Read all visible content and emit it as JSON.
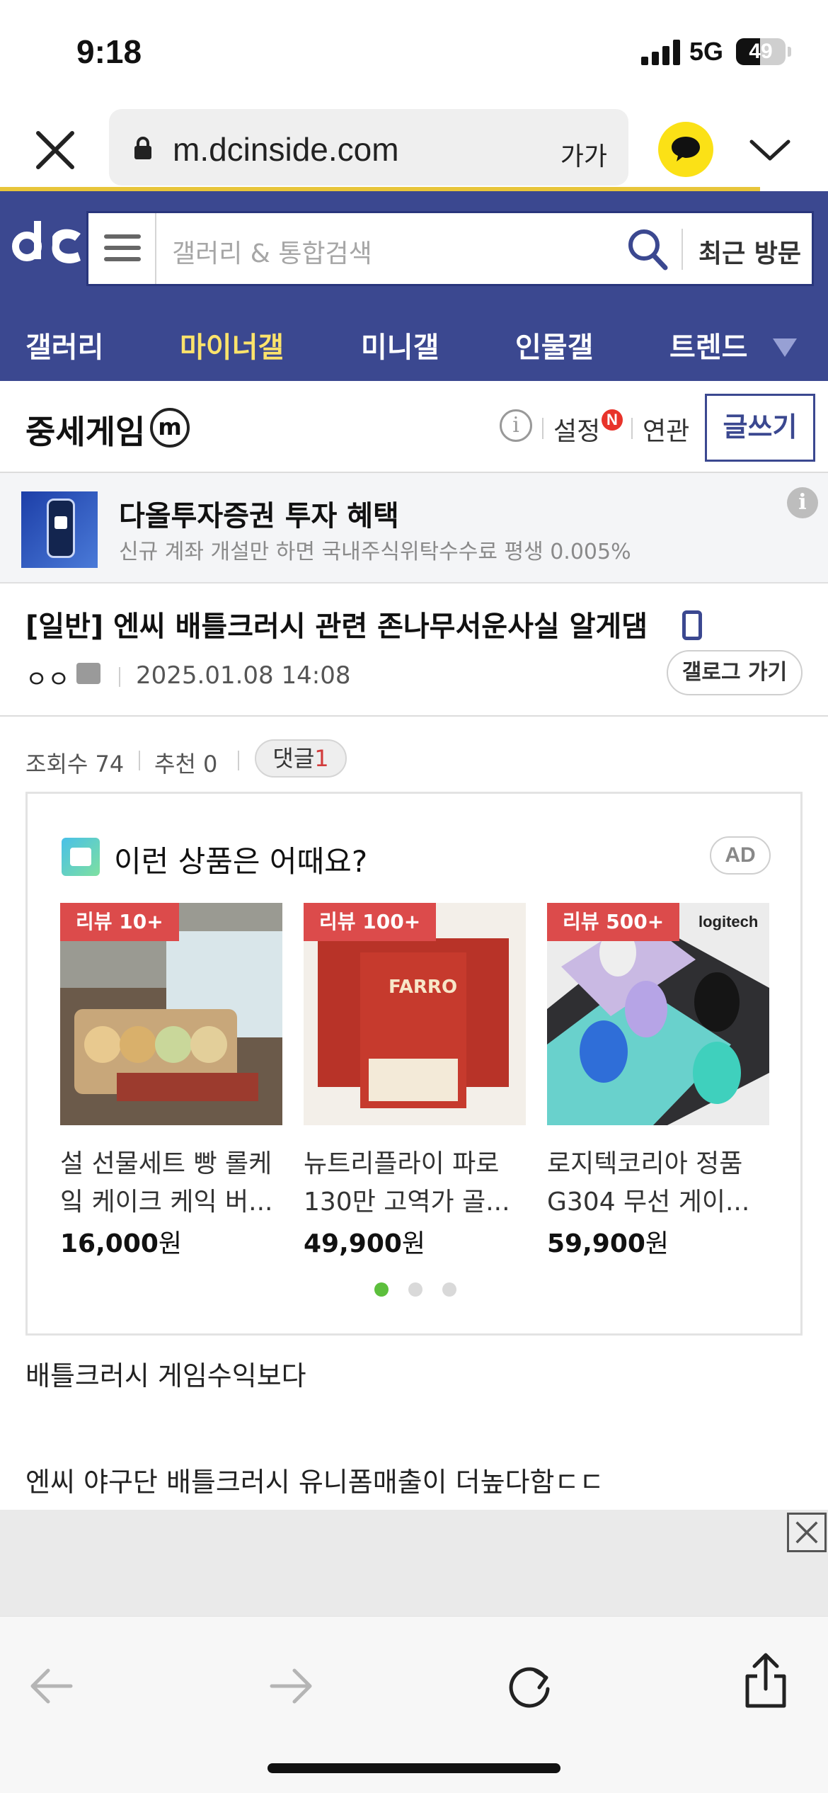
{
  "status_bar": {
    "time": "9:18",
    "network": "5G",
    "battery": "49",
    "battery_level": 49
  },
  "browser": {
    "url": "m.dcinside.com",
    "text_size_label": "가가"
  },
  "header": {
    "search_placeholder": "갤러리 & 통합검색",
    "recent_label": "최근 방문"
  },
  "nav": {
    "items": [
      "갤러리",
      "마이너갤",
      "미니갤",
      "인물갤",
      "트렌드"
    ],
    "active": "마이너갤"
  },
  "gallery": {
    "title": "중세게임",
    "badge": "m",
    "info_icon": "i",
    "setting_label": "설정",
    "new_badge": "N",
    "related_label": "연관",
    "write_label": "글쓰기"
  },
  "ad_banner": {
    "title": "다올투자증권 투자 혜택",
    "desc": "신규 계좌 개설만 하면 국내주식위탁수수료 평생 0.005%",
    "info_icon": "i"
  },
  "post": {
    "title": "[일반] 엔씨 배틀크러시 관련 존나무서운사실 알게댐",
    "author": "ㅇㅇ",
    "date": "2025.01.08 14:08",
    "gallog_label": "갤로그 가기",
    "views": "조회수 74",
    "recommend": "추천 0",
    "comment_label": "댓글",
    "comment_count": "1",
    "body": [
      "배틀크러시 게임수익보다",
      "엔씨 야구단 배틀크러시 유니폼매출이 더높다함ㄷㄷ"
    ]
  },
  "product_ad": {
    "heading": "이런 상품은 어때요?",
    "ad_label": "AD",
    "products": [
      {
        "review": "리뷰 10+",
        "name_line1": "설 선물세트 빵 롤케",
        "name_line2": "잌 케이크 케익 버...",
        "price": "16,000",
        "currency": "원"
      },
      {
        "review": "리뷰 100+",
        "name_line1": "뉴트리플라이 파로",
        "name_line2": "130만 고역가 골...",
        "price": "49,900",
        "currency": "원",
        "brand": "FARRO"
      },
      {
        "review": "리뷰 500+",
        "name_line1": "로지텍코리아 정품",
        "name_line2": "G304 무선 게이...",
        "price": "59,900",
        "currency": "원",
        "brand": "logitech"
      }
    ]
  }
}
